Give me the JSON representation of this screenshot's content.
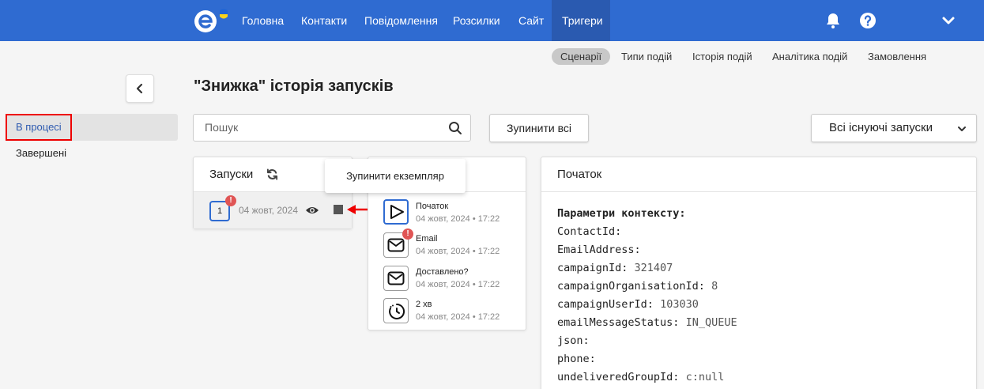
{
  "nav": {
    "items": [
      {
        "label": "Головна"
      },
      {
        "label": "Контакти"
      },
      {
        "label": "Повідомлення"
      },
      {
        "label": "Розсилки"
      },
      {
        "label": "Сайт"
      },
      {
        "label": "Тригери"
      }
    ],
    "active": "Тригери",
    "icons": [
      "bell-icon",
      "help-icon",
      "chevron-down-icon"
    ],
    "brand_color": "#2f6bd1"
  },
  "subnav": {
    "items": [
      {
        "label": "Сценарії"
      },
      {
        "label": "Типи подій"
      },
      {
        "label": "Історія подій"
      },
      {
        "label": "Аналітика подій"
      },
      {
        "label": "Замовлення"
      }
    ],
    "active": "Сценарії"
  },
  "sidebar": {
    "items": [
      {
        "label": "В процесі"
      },
      {
        "label": "Завершені"
      }
    ],
    "active": "В процесі"
  },
  "page": {
    "title": "\"Знижка\" історія запусків"
  },
  "search": {
    "placeholder": "Пошук",
    "value": ""
  },
  "toolbar": {
    "stop_all_label": "Зупинити всі",
    "filter_label": "Всі існуючі запуски"
  },
  "runs": {
    "title": "Запуски",
    "items": [
      {
        "number": "1",
        "date": "04 жовт, 2024",
        "alert": "!"
      }
    ]
  },
  "tooltip": {
    "text": "Зупинити екземпляр"
  },
  "steps": {
    "items": [
      {
        "name": "Початок",
        "date": "04 жовт, 2024 • 17:22",
        "icon": "play-icon"
      },
      {
        "name": "Email",
        "date": "04 жовт, 2024 • 17:22",
        "icon": "mail-icon",
        "alert": "!"
      },
      {
        "name": "Доставлено?",
        "date": "04 жовт, 2024 • 17:22",
        "icon": "mail-icon"
      },
      {
        "name": "2 хв",
        "date": "04 жовт, 2024 • 17:22",
        "icon": "timer-icon"
      }
    ]
  },
  "detail": {
    "title": "Початок",
    "context_heading": "Параметри контексту:",
    "params": [
      {
        "key": "ContactId:",
        "value": ""
      },
      {
        "key": "EmailAddress:",
        "value": ""
      },
      {
        "key": "campaignId:",
        "value": "321407"
      },
      {
        "key": "campaignOrganisationId:",
        "value": "8"
      },
      {
        "key": "campaignUserId:",
        "value": "103030"
      },
      {
        "key": "emailMessageStatus:",
        "value": "IN_QUEUE"
      },
      {
        "key": "json:",
        "value": ""
      },
      {
        "key": "phone:",
        "value": ""
      },
      {
        "key": "undeliveredGroupId:",
        "value": "c:null"
      }
    ]
  }
}
